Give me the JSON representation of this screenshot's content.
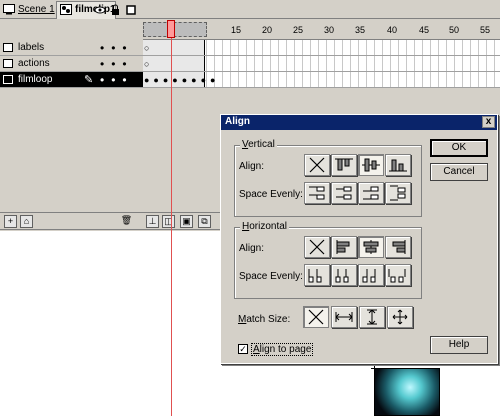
{
  "tabs": {
    "scene": "Scene 1",
    "clip": "filmclip1"
  },
  "ruler": {
    "ticks": [
      "15",
      "20",
      "25",
      "30",
      "35",
      "40",
      "45",
      "50",
      "55"
    ]
  },
  "layers": [
    {
      "name": "labels"
    },
    {
      "name": "actions"
    },
    {
      "name": "filmloop"
    }
  ],
  "dialog": {
    "title": "Align",
    "close": "x",
    "vertical": {
      "title_u": "V",
      "title_rest": "ertical",
      "align_label": "Align:",
      "space_label": "Space Evenly:"
    },
    "horizontal": {
      "title_u": "H",
      "title_rest": "orizontal",
      "align_label": "Align:",
      "space_label": "Space Evenly:"
    },
    "match_size": {
      "label_u": "M",
      "label_rest": "atch Size:"
    },
    "ok": "OK",
    "cancel": "Cancel",
    "help": "Help",
    "align_to_page": {
      "checked": "✓",
      "label_u": "A",
      "label_rest": "lign to page"
    }
  },
  "colors": {
    "titlebar": "#0a246a",
    "playhead": "#e05050",
    "selected_layer": "#000000"
  }
}
